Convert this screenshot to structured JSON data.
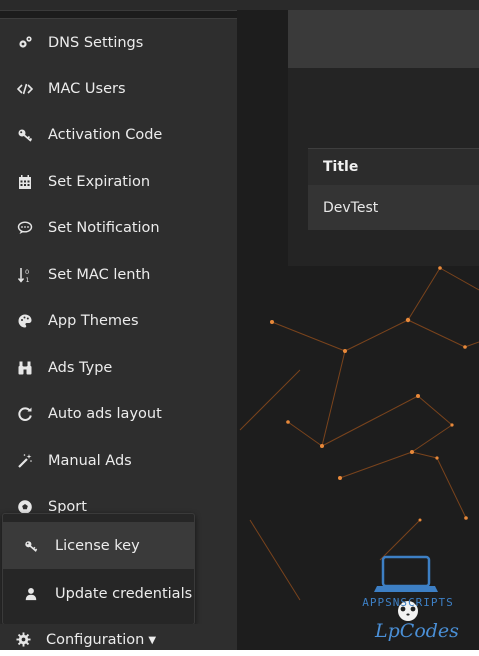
{
  "sidebar": {
    "items": [
      {
        "label": "DNS Settings",
        "icon": "gears-icon"
      },
      {
        "label": "MAC Users",
        "icon": "code-icon"
      },
      {
        "label": "Activation Code",
        "icon": "key-icon"
      },
      {
        "label": "Set Expiration",
        "icon": "calendar-icon"
      },
      {
        "label": "Set Notification",
        "icon": "comment-icon"
      },
      {
        "label": "Set MAC lenth",
        "icon": "sort-numeric-icon"
      },
      {
        "label": "App Themes",
        "icon": "palette-icon"
      },
      {
        "label": "Ads Type",
        "icon": "binoculars-icon"
      },
      {
        "label": "Auto ads layout",
        "icon": "refresh-icon"
      },
      {
        "label": "Manual Ads",
        "icon": "magic-wand-icon"
      },
      {
        "label": "Sport",
        "icon": "soccer-ball-icon"
      }
    ]
  },
  "dropdown": {
    "items": [
      {
        "label": "License key",
        "icon": "key-icon"
      },
      {
        "label": "Update credentials",
        "icon": "user-icon"
      }
    ]
  },
  "config": {
    "label": "Configuration",
    "icon": "gear-icon"
  },
  "table": {
    "header": "Title",
    "rows": [
      "DevTest"
    ]
  },
  "watermark": {
    "line1": "APPSNSCRIPTS",
    "line2": "LpCodes"
  },
  "colors": {
    "accent_network": "#d9822b",
    "watermark": "#3d7fc4"
  }
}
